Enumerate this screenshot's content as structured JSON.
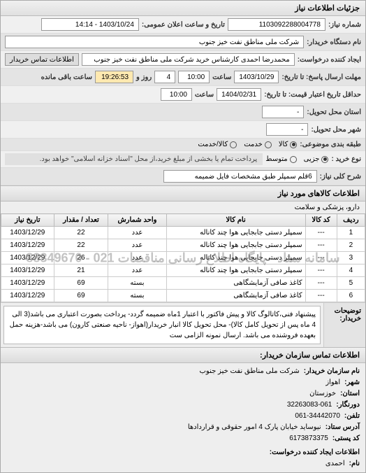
{
  "header": {
    "title": "جزئیات اطلاعات نیاز"
  },
  "top": {
    "reqnum_label": "شماره نیاز:",
    "reqnum": "1103092288004778",
    "announce_label": "تاریخ و ساعت اعلان عمومی:",
    "announce": "1403/10/24 - 14:14",
    "buyer_org_label": "نام دستگاه خریدار:",
    "buyer_org": "شرکت ملی مناطق نفت خیز جنوب",
    "creator_label": "ایجاد کننده درخواست:",
    "creator": "محمدرضا احمدی  کارشناس خرید  شرکت ملی مناطق نفت خیز جنوب",
    "contact_btn": "اطلاعات تماس خریدار",
    "deadline_from_label": "مهلت ارسال پاسخ: تا تاریخ:",
    "deadline_date": "1403/10/29",
    "time_label": "ساعت",
    "deadline_time": "10:00",
    "days_remain_label": "روز و",
    "days_remain": "4",
    "time_remain_label": "ساعت باقی مانده",
    "time_remain": "19:26:53",
    "validity_label": "حداقل تاریخ اعتبار قیمت: تا تاریخ:",
    "validity_date": "1404/02/31",
    "validity_time": "10:00",
    "delivery_province_label": "استان محل تحویل:",
    "delivery_province": "-",
    "delivery_city_label": "شهر محل تحویل:",
    "delivery_city": "-",
    "budget_label": "طبقه بندی موضوعی:",
    "opt_kala": "کالا",
    "opt_khedmat": "خدمت",
    "opt_kala_khedmat": "کالا/خدمت",
    "purchase_type_label": "نوع خرید :",
    "opt_jozi": "جزیی",
    "opt_mutavasset": "متوسط",
    "purchase_note": "پرداخت تمام یا بخشی از مبلغ خرید،از محل \"اسناد خزانه اسلامی\" خواهد بود.",
    "need_desc_label": "شرح کلی نیاز:",
    "need_desc": "6قلم سمپلر طبق مشخصات فایل ضمیمه"
  },
  "goods_section": {
    "title": "اطلاعات کالاهای مورد نیاز",
    "category": "دارو، پزشکی و سلامت"
  },
  "table": {
    "headers": [
      "ردیف",
      "کد کالا",
      "نام کالا",
      "واحد شمارش",
      "تعداد / مقدار",
      "تاریخ نیاز"
    ],
    "rows": [
      [
        "1",
        "---",
        "سمپلر دستی جابجایی هوا چند کاناله",
        "عدد",
        "22",
        "1403/12/29"
      ],
      [
        "2",
        "---",
        "سمپلر دستی جابجایی هوا چند کاناله",
        "عدد",
        "22",
        "1403/12/29"
      ],
      [
        "3",
        "---",
        "سمپلر دستی جابجایی هوا چند کاناله",
        "عدد",
        "26",
        "1403/12/29"
      ],
      [
        "4",
        "---",
        "سمپلر دستی جابجایی هوا چند کاناله",
        "عدد",
        "21",
        "1403/12/29"
      ],
      [
        "5",
        "---",
        "کاغذ صافی آزمایشگاهی",
        "بسته",
        "69",
        "1403/12/29"
      ],
      [
        "6",
        "---",
        "کاغذ صافی آزمایشگاهی",
        "بسته",
        "69",
        "1403/12/29"
      ]
    ],
    "watermark": "سامانه ستاد - پایگاه اطلاع رسانی مناقصات\n021 - 88349670"
  },
  "desc": {
    "label": "توضیحات خریدار:",
    "text": "پیشنهاد فنی،کاتالوگ کالا و پیش فاکتور با اعتبار 1ماه ضمیمه گردد- پرداخت بصورت اعتباری می باشد(3 الی 4 ماه پس از تحویل کامل کالا)- محل تحویل کالا انبار خریدار(اهواز- ناحیه صنعتی کارون) می باشد-هزینه حمل بعهده فروشنده می باشد. ارسال نمونه الزامی ست"
  },
  "contact": {
    "title": "اطلاعات تماس سازمان خریدار:",
    "org_label": "نام سازمان خریدار:",
    "org": "شرکت ملی مناطق نفت خیز جنوب",
    "city_label": "شهر:",
    "city": "اهواز",
    "province_label": "استان:",
    "province": "خوزستان",
    "fax_label": "دورنگار:",
    "fax": "32263083-061",
    "phone_label": "تلفن:",
    "phone": "061-34442070",
    "address_label": "آدرس ستاد:",
    "address": "نیوساید خیابان پارک 4 امور حقوقی و قراردادها",
    "postal_label": "کد پستی:",
    "postal": "6173873375",
    "req_creator_label": "اطلاعات ایجاد کننده درخواست:",
    "req_creator_name_label": "نام:",
    "req_creator_name": "احمدی"
  }
}
